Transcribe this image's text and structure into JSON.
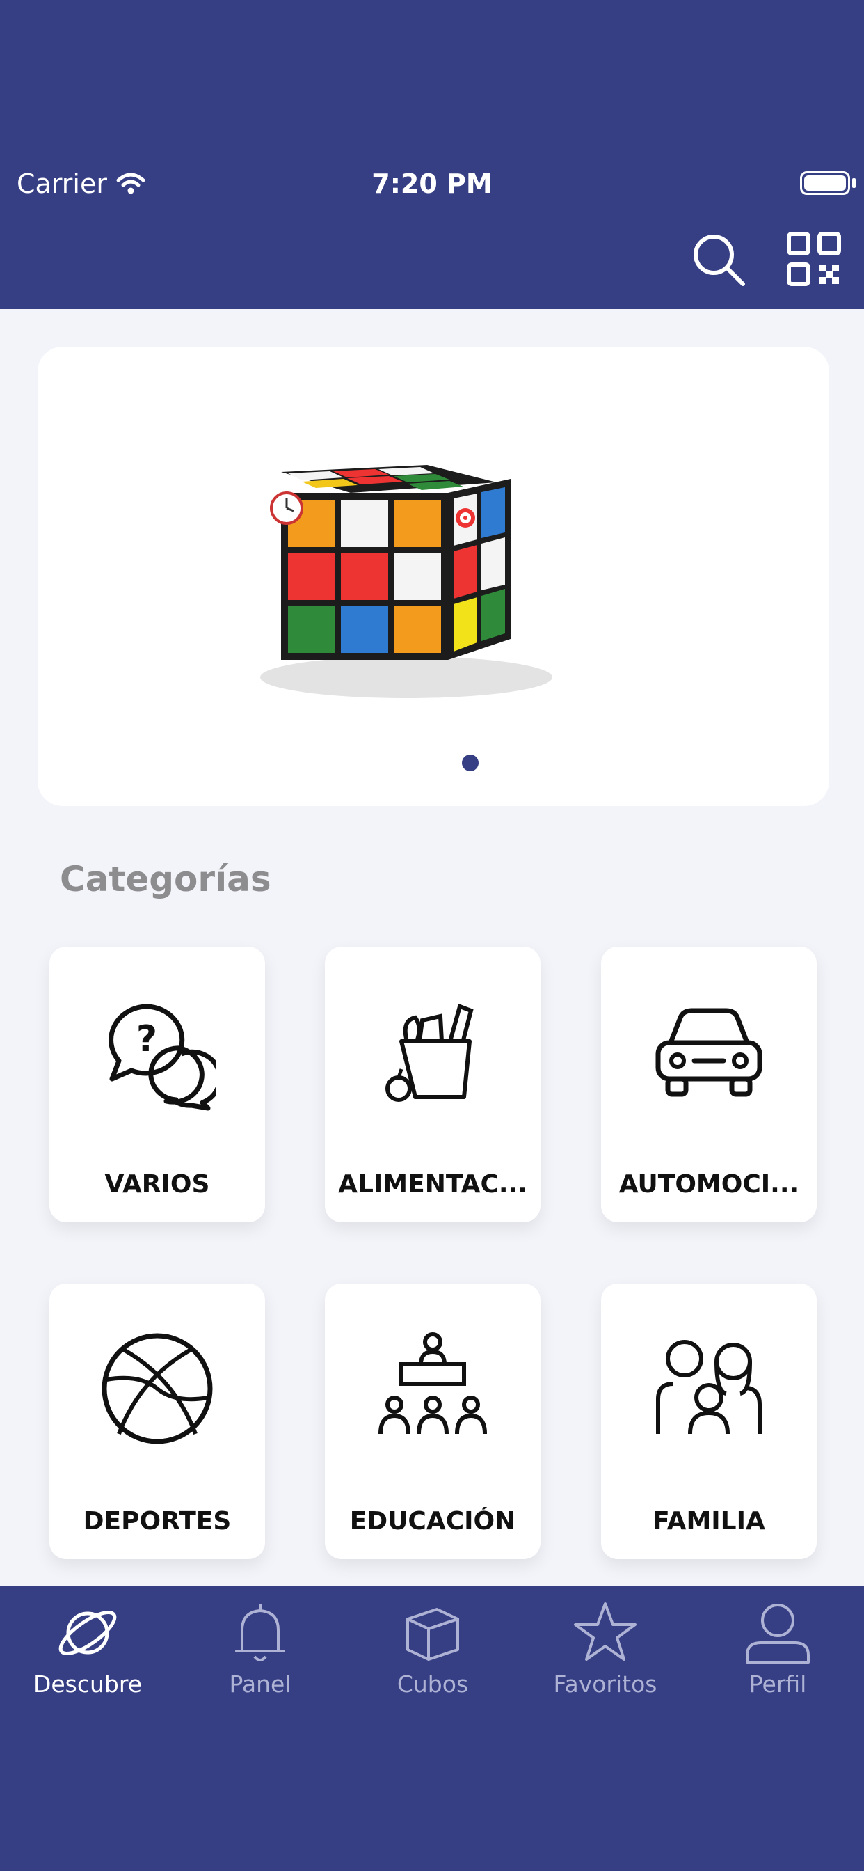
{
  "status_bar": {
    "carrier": "Carrier",
    "time": "7:20 PM"
  },
  "header": {
    "icons": [
      "search-icon",
      "qr-code-icon"
    ]
  },
  "banner": {
    "image": "rubiks-cube-illustration",
    "page_indicator": {
      "current": 1,
      "total": 1
    }
  },
  "categories": {
    "title": "Categorías",
    "items": [
      {
        "label": "VARIOS",
        "icon": "question-chat-icon"
      },
      {
        "label": "ALIMENTAC...",
        "icon": "groceries-icon"
      },
      {
        "label": "AUTOMOCI...",
        "icon": "car-icon"
      },
      {
        "label": "DEPORTES",
        "icon": "basketball-icon"
      },
      {
        "label": "EDUCACIÓN",
        "icon": "classroom-icon"
      },
      {
        "label": "FAMILIA",
        "icon": "family-icon"
      }
    ]
  },
  "tab_bar": {
    "items": [
      {
        "label": "Descubre",
        "icon": "planet-icon",
        "active": true
      },
      {
        "label": "Panel",
        "icon": "bell-icon",
        "active": false
      },
      {
        "label": "Cubos",
        "icon": "cube-icon",
        "active": false
      },
      {
        "label": "Favoritos",
        "icon": "star-icon",
        "active": false
      },
      {
        "label": "Perfil",
        "icon": "user-icon",
        "active": false
      }
    ]
  },
  "colors": {
    "primary": "#363f84",
    "background": "#f3f4f9",
    "section_title": "#8d8d8f",
    "tab_inactive": "#aeb2d4"
  }
}
